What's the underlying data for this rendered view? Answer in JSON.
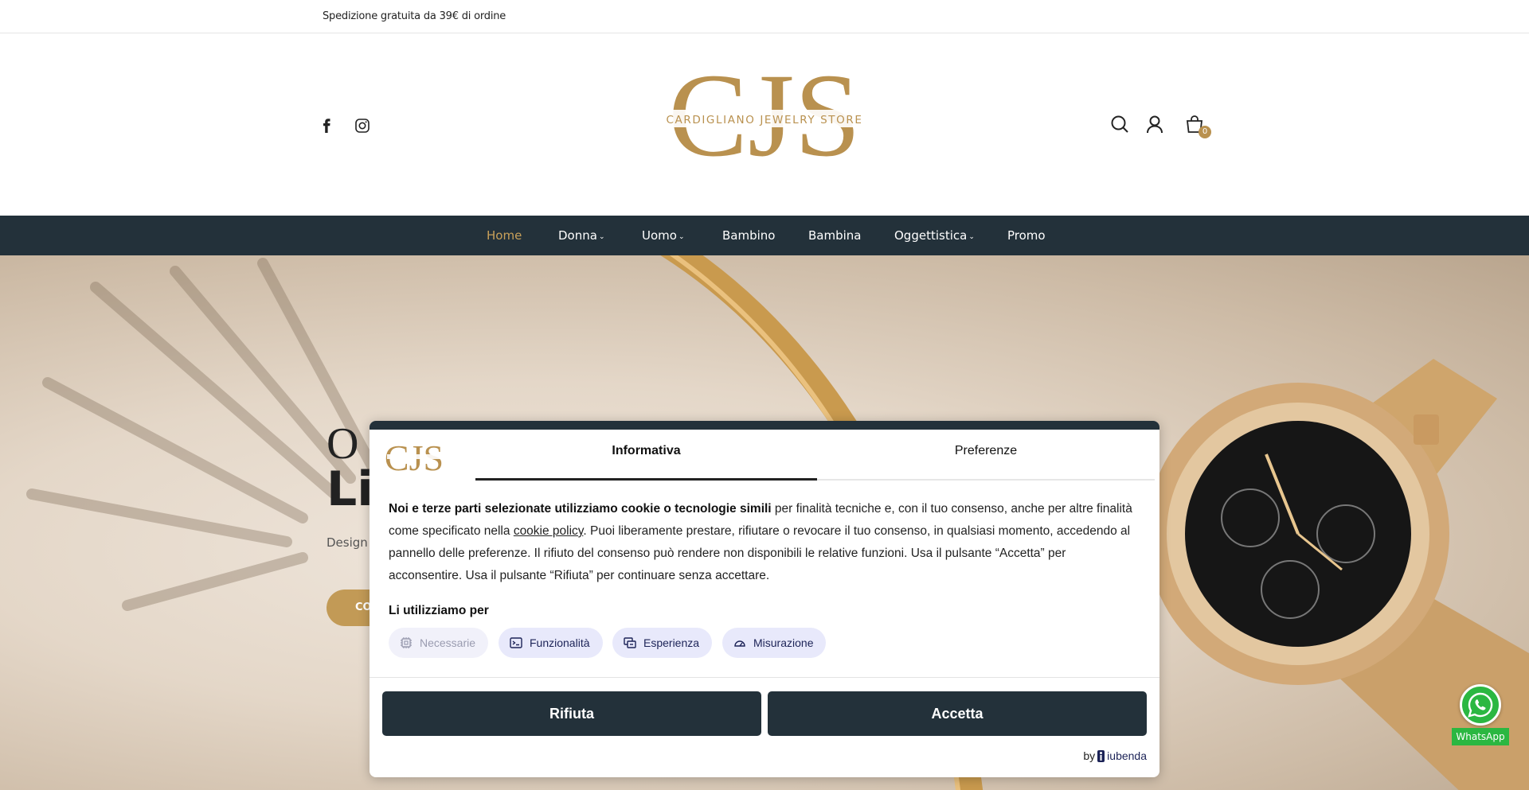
{
  "topbar": {
    "text": "Spedizione gratuita da 39€ di ordine"
  },
  "header": {
    "logo": {
      "initials": "CJS",
      "tagline": "CARDIGLIANO JEWELRY STORE"
    },
    "cart_count": "0"
  },
  "nav": {
    "items": [
      {
        "label": "Home",
        "active": true
      },
      {
        "label": "Donna",
        "has_dropdown": true
      },
      {
        "label": "Uomo",
        "has_dropdown": true
      },
      {
        "label": "Bambino"
      },
      {
        "label": "Bambina"
      },
      {
        "label": "Oggettistica",
        "has_dropdown": true
      },
      {
        "label": "Promo"
      }
    ]
  },
  "hero": {
    "title_line1": "O",
    "title_line2": "Li",
    "subtitle": "Design c",
    "button": "CO"
  },
  "whatsapp": {
    "label": "WhatsApp"
  },
  "cookie": {
    "logo_text": "CJS",
    "tabs": [
      {
        "label": "Informativa",
        "active": true
      },
      {
        "label": "Preferenze",
        "active": false
      }
    ],
    "body_bold": "Noi e terze parti selezionate utilizziamo cookie o tecnologie simili",
    "body_part1": " per finalità tecniche e, con il tuo consenso, anche per altre finalità come specificato nella ",
    "body_link": "cookie policy",
    "body_part2": ". Puoi liberamente prestare, rifiutare o revocare il tuo consenso, in qualsiasi momento, accedendo al pannello delle preferenze. Il rifiuto del consenso può rendere non disponibili le relative funzioni. Usa il pulsante “Accetta” per acconsentire. Usa il pulsante “Rifiuta” per continuare senza accettare.",
    "usage_title": "Li utilizziamo per",
    "chips": [
      {
        "label": "Necessarie",
        "disabled": true
      },
      {
        "label": "Funzionalità"
      },
      {
        "label": "Esperienza"
      },
      {
        "label": "Misurazione"
      }
    ],
    "reject_label": "Rifiuta",
    "accept_label": "Accetta",
    "by_label": "by",
    "brand_label": "iubenda"
  },
  "colors": {
    "nav_bg": "#23313a",
    "accent_gold": "#c29a56",
    "chip_bg": "#e8e9fb",
    "whatsapp_green": "#2bb741"
  }
}
